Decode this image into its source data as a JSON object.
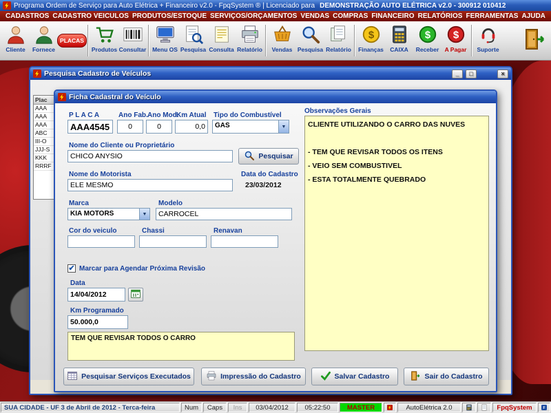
{
  "icons": {
    "check": "✔",
    "combo_arrow": "▼",
    "minimize": "_",
    "maximize": "□",
    "close": "×"
  },
  "app": {
    "title_normal": "Programa Ordem de Serviço para Auto Elétrica + Financeiro v2.0 - FpqSystem ® | Licenciado para",
    "title_bold": "DEMONSTRAÇÃO AUTO ELÉTRICA v2.0 - 300912 010412"
  },
  "menu": {
    "items": [
      "CADASTROS",
      "CADASTRO VEICULOS",
      "PRODUTOS/ESTOQUE",
      "SERVIÇOS/ORÇAMENTOS",
      "VENDAS",
      "COMPRAS",
      "FINANCEIRO",
      "RELATÓRIOS",
      "FERRAMENTAS",
      "AJUDA"
    ]
  },
  "toolbar": {
    "buttons": [
      {
        "label": "Cliente"
      },
      {
        "label": "Fornece"
      },
      {
        "label": "PLACAS"
      },
      {
        "label": "Produtos"
      },
      {
        "label": "Consultar"
      },
      {
        "label": "Menu OS"
      },
      {
        "label": "Pesquisa"
      },
      {
        "label": "Consulta"
      },
      {
        "label": "Relatório"
      },
      {
        "label": "Vendas"
      },
      {
        "label": "Pesquisa"
      },
      {
        "label": "Relatório"
      },
      {
        "label": "Finanças"
      },
      {
        "label": "CAIXA"
      },
      {
        "label": "Receber"
      },
      {
        "label": "A Pagar"
      },
      {
        "label": "Suporte"
      }
    ]
  },
  "outer_window": {
    "title": "Pesquisa Cadastro de Veículos",
    "grid": {
      "header": "Plac",
      "rows": [
        "AAA",
        "AAA",
        "AAA",
        "ABC",
        "III-O",
        "JJJ-S",
        "KKK",
        "RRRF"
      ]
    }
  },
  "form": {
    "title": "Ficha Cadastral do Veículo",
    "placa_label": "P L A C A",
    "placa_value": "AAA4545",
    "ano_fab_label": "Ano Fab.",
    "ano_fab_value": "0",
    "ano_mod_label": "Ano Mod.",
    "ano_mod_value": "0",
    "km_atual_label": "Km Atual",
    "km_atual_value": "0,0",
    "combustivel_label": "Tipo do Combustível",
    "combustivel_value": "GAS",
    "cliente_label": "Nome do Cliente ou Proprietário",
    "cliente_value": "CHICO ANYSIO",
    "pesquisar_button": "Pesquisar",
    "motorista_label": "Nome do Motorista",
    "motorista_value": "ELE MESMO",
    "data_cadastro_label": "Data do Cadastro",
    "data_cadastro_value": "23/03/2012",
    "marca_label": "Marca",
    "marca_value": "KIA MOTORS",
    "modelo_label": "Modelo",
    "modelo_value": "CARROCEL",
    "cor_label": "Cor do veiculo",
    "cor_value": "",
    "chassi_label": "Chassi",
    "chassi_value": "",
    "renavan_label": "Renavan",
    "renavan_value": "",
    "revisao_check_label": "Marcar para Agendar Próxima Revisão",
    "data_revisao_label": "Data",
    "data_revisao_value": "14/04/2012",
    "km_prog_label": "Km Programado",
    "km_prog_value": "50.000,0",
    "revisao_nota": "TEM QUE REVISAR TODOS O CARRO",
    "obs_label": "Observações Gerais",
    "obs_value": "CLIENTE UTILIZANDO O CARRO DAS NUVES\n\n- TEM QUE REVISAR TODOS OS ITENS\n- VEIO SEM COMBUSTIVEL\n- ESTA TOTALMENTE QUEBRADO",
    "buttons": {
      "pesquisar_servicos": "Pesquisar Serviços Executados",
      "impressao": "Impressão do Cadastro",
      "salvar": "Salvar Cadastro",
      "sair": "Sair do Cadastro"
    }
  },
  "statusbar": {
    "location": "SUA CIDADE - UF  3 de Abril de 2012 - Terca-feira",
    "num": "Num",
    "caps": "Caps",
    "ins": "Ins",
    "date": "03/04/2012",
    "time": "05:22:50",
    "user": "MASTER",
    "app_name": "AutoElétrica 2.0",
    "brand": "FpqSystem"
  }
}
